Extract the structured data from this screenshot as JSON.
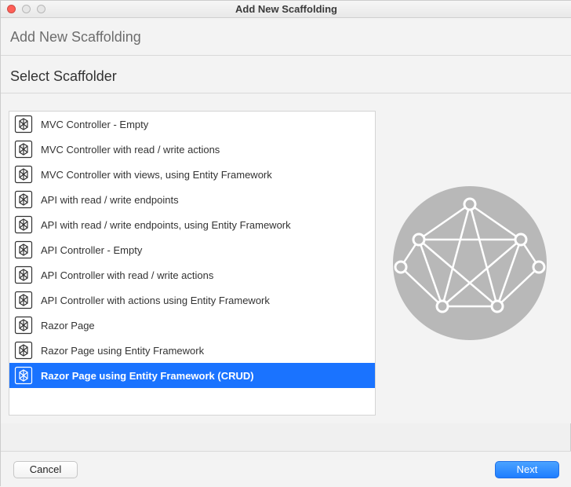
{
  "window": {
    "title": "Add New Scaffolding"
  },
  "header": {
    "title": "Add New Scaffolding"
  },
  "section": {
    "label": "Select Scaffolder"
  },
  "scaffolders": [
    {
      "label": "MVC Controller - Empty",
      "selected": false
    },
    {
      "label": "MVC Controller with read / write actions",
      "selected": false
    },
    {
      "label": "MVC Controller with views, using Entity Framework",
      "selected": false
    },
    {
      "label": "API with read / write endpoints",
      "selected": false
    },
    {
      "label": "API with read / write endpoints, using Entity Framework",
      "selected": false
    },
    {
      "label": "API Controller - Empty",
      "selected": false
    },
    {
      "label": "API Controller with read / write actions",
      "selected": false
    },
    {
      "label": "API Controller with actions using Entity Framework",
      "selected": false
    },
    {
      "label": "Razor Page",
      "selected": false
    },
    {
      "label": "Razor Page using Entity Framework",
      "selected": false
    },
    {
      "label": "Razor Page using Entity Framework (CRUD)",
      "selected": true
    }
  ],
  "buttons": {
    "cancel": "Cancel",
    "next": "Next"
  }
}
